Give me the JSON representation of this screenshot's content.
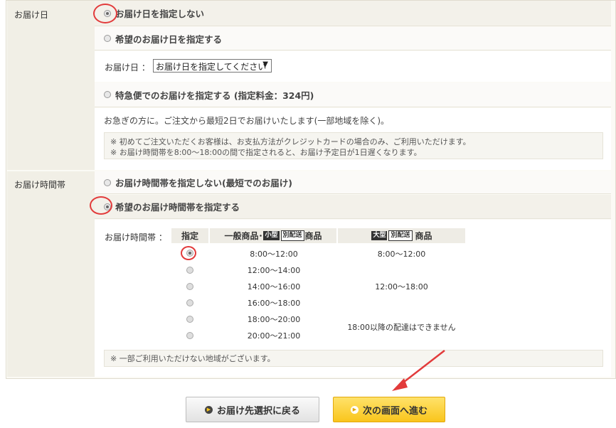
{
  "delivery_date": {
    "section_label": "お届け日",
    "option_none": "お届け日を指定しない",
    "option_specify": "希望のお届け日を指定する",
    "date_field_label": "お届け日 ：",
    "date_select_value": "お届け日を指定してください",
    "option_express": "特急便でのお届けを指定する (指定料金：324円)",
    "express_desc": "お急ぎの方に。ご注文から最短2日でお届けいたします(一部地域を除く)。",
    "note_1": "※ 初めてご注文いただくお客様は、お支払方法がクレジットカードの場合のみ、ご利用いただけます。",
    "note_2": "※ お届け時間帯を8:00～18:00の間で指定されると、お届け予定日が1日遅くなります。"
  },
  "delivery_time": {
    "section_label": "お届け時間帯",
    "option_none": "お届け時間帯を指定しない(最短でのお届け)",
    "option_specify": "希望のお届け時間帯を指定する",
    "table_label": "お届け時間帯 ：",
    "col_select": "指定",
    "col_general_prefix": "一般商品･",
    "col_general_tag1": "小型",
    "col_general_tag2": "別配送",
    "col_general_suffix": "商品",
    "col_large_tag1": "大型",
    "col_large_tag2": "別配送",
    "col_large_suffix": "商品",
    "slots": [
      "8:00～12:00",
      "12:00～14:00",
      "14:00～16:00",
      "16:00～18:00",
      "18:00～20:00",
      "20:00～21:00"
    ],
    "large_slot_1": "8:00～12:00",
    "large_slot_2": "12:00～18:00",
    "large_note": "18:00以降の配達はできません",
    "footnote": "※ 一部ご利用いただけない地域がございます。"
  },
  "buttons": {
    "back": "お届け先選択に戻る",
    "next": "次の画面へ進む"
  },
  "colors": {
    "highlight_red": "#e23b3b",
    "next_button": "#f9c51c"
  }
}
